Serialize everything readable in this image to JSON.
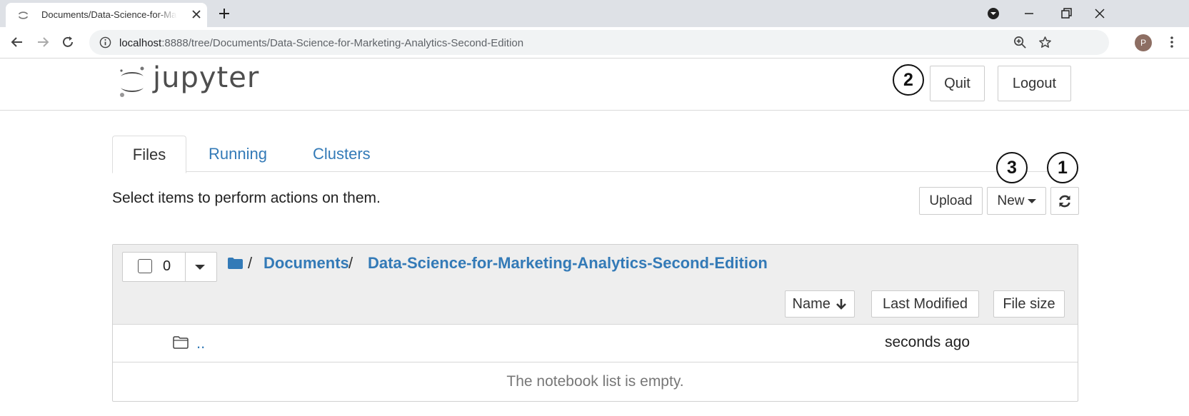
{
  "browser": {
    "tab_title": "Documents/Data-Science-for-Marketing-Analytics-Second-Edition",
    "url_host": "localhost",
    "url_path": ":8888/tree/Documents/Data-Science-for-Marketing-Analytics-Second-Edition",
    "profile_initial": "P"
  },
  "header": {
    "logo_text": "jupyter",
    "quit_label": "Quit",
    "logout_label": "Logout"
  },
  "callouts": {
    "one": "1",
    "two": "2",
    "three": "3"
  },
  "tabs": [
    {
      "label": "Files"
    },
    {
      "label": "Running"
    },
    {
      "label": "Clusters"
    }
  ],
  "toolbar": {
    "message": "Select items to perform actions on them.",
    "upload_label": "Upload",
    "new_label": "New"
  },
  "list": {
    "selected_count": "0",
    "breadcrumb": [
      "Documents",
      "Data-Science-for-Marketing-Analytics-Second-Edition"
    ],
    "breadcrumb_separator": "/",
    "sort_name": "Name",
    "sort_modified": "Last Modified",
    "sort_size": "File size",
    "rows": [
      {
        "name": "..",
        "modified": "seconds ago"
      }
    ],
    "empty_message": "The notebook list is empty."
  },
  "colors": {
    "link": "#337ab7",
    "logo_orange": "#f37726",
    "folder_icon": "#337ab7"
  }
}
